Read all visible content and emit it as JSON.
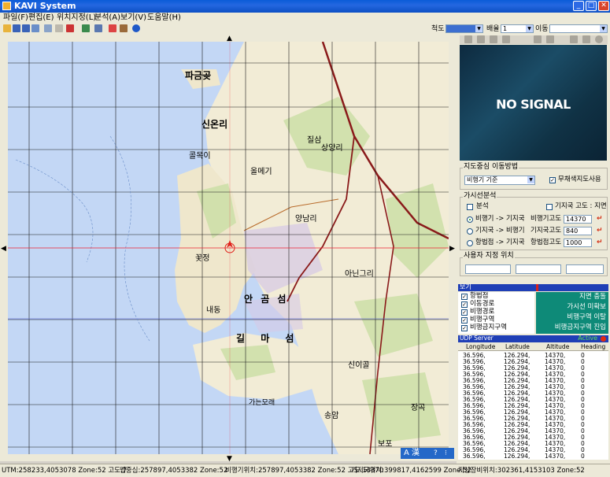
{
  "window": {
    "title": "KAVI System"
  },
  "menu": [
    "파일(F)",
    "편집(E)",
    "위치지정(L)",
    "분석(A)",
    "보기(V)",
    "도움말(H)"
  ],
  "toolbar": {
    "scale_label": "척도",
    "scale_value": "",
    "ratio_label": "배율",
    "ratio_value": "1",
    "move_label": "이동",
    "move_value": ""
  },
  "video": {
    "text": "NO SIGNAL"
  },
  "map_center": {
    "title": "지도중심 이동방법",
    "mode_value": "비행기 기준",
    "no_map_label": "무채색지도사용",
    "no_map_checked": true
  },
  "visibility": {
    "title": "가시선분석",
    "analysis_label": "분석",
    "ground_alt_label": "기지국 고도 : 지면",
    "options": [
      "비행기 -> 기지국",
      "기지국 -> 비행기",
      "항법점 -> 기지국"
    ],
    "selected_option": 0,
    "fields": [
      {
        "label": "비행기고도",
        "value": "14370"
      },
      {
        "label": "기지국고도",
        "value": "840"
      },
      {
        "label": "항법점고도",
        "value": "1000"
      }
    ]
  },
  "user_location": {
    "title": "사용자 지정 위치"
  },
  "view_panel": {
    "title": "보기",
    "layers": [
      {
        "label": "항법점",
        "checked": true
      },
      {
        "label": "이동경로",
        "checked": true
      },
      {
        "label": "비행경로",
        "checked": true
      },
      {
        "label": "비행구역",
        "checked": true
      },
      {
        "label": "비행금지구역",
        "checked": true
      }
    ],
    "legend": [
      "지면 충돌",
      "가시선 미확보",
      "비행구역 이탈",
      "비행금지구역 진입"
    ]
  },
  "udp": {
    "title": "UDP Server",
    "status": "Active",
    "columns": [
      "Longitude",
      "Latitude",
      "Altitude",
      "Heading"
    ],
    "rows": [
      [
        "36.596,",
        "126.294,",
        "14370,",
        "0"
      ],
      [
        "36.596,",
        "126.294,",
        "14370,",
        "0"
      ],
      [
        "36.596,",
        "126.294,",
        "14370,",
        "0"
      ],
      [
        "36.596,",
        "126.294,",
        "14370,",
        "0"
      ],
      [
        "36.596,",
        "126.294,",
        "14370,",
        "0"
      ],
      [
        "36.596,",
        "126.294,",
        "14370,",
        "0"
      ],
      [
        "36.596,",
        "126.294,",
        "14370,",
        "0"
      ],
      [
        "36.596,",
        "126.294,",
        "14370,",
        "0"
      ],
      [
        "36.596,",
        "126.294,",
        "14370,",
        "0"
      ],
      [
        "36.596,",
        "126.294,",
        "14370,",
        "0"
      ],
      [
        "36.596,",
        "126.294,",
        "14370,",
        "0"
      ],
      [
        "36.596,",
        "126.294,",
        "14370,",
        "0"
      ],
      [
        "36.596,",
        "126.294,",
        "14370,",
        "0"
      ],
      [
        "36.596,",
        "126.294,",
        "14370,",
        "0"
      ],
      [
        "36.596,",
        "126.294,",
        "14370,",
        "0"
      ],
      [
        "36.596,",
        "126.294,",
        "14370,",
        "0"
      ],
      [
        "36.596,",
        "126.294,",
        "14370,",
        "0"
      ]
    ]
  },
  "map_labels": {
    "pagokgot": "파금곶",
    "sinonri": "신온리",
    "keolmoki": "콜목이",
    "kkojeong": "꽃정",
    "naedong": "내동",
    "angomseom": "안 곰 섬",
    "gilmaseom": "길 마 섬",
    "aniguri": "아닌그리",
    "yongmeki": "올메기",
    "jinsal": "질삼",
    "yangnam": "양남리",
    "sarngyangri": "상양리",
    "gaenunmorae": "가는모래",
    "beppo": "보포",
    "jangok": "장곡",
    "songam": "송암",
    "sinigol": "신이골"
  },
  "map_bar": {
    "label": "A 漢"
  },
  "status": {
    "utm": "UTM:258233,4053078 Zone:52 고도:7",
    "center": "맵중심:257897,4053382 Zone:52",
    "aircraft": "비행기위치:257897,4053382 Zone:52 고도:14370",
    "station": "기지국위치:399817,4162599 Zone:52",
    "ground_equip": "지상장비위치:302361,4153103 Zone:52"
  }
}
